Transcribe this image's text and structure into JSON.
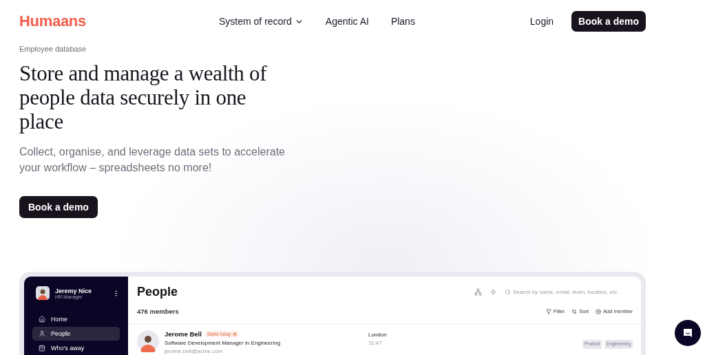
{
  "brand": "Humaans",
  "nav": [
    {
      "label": "System of record",
      "kind": "menu"
    },
    {
      "label": "Agentic AI",
      "kind": "link"
    },
    {
      "label": "Plans",
      "kind": "link"
    }
  ],
  "login": "Login",
  "header_cta": "Book a demo",
  "hero": {
    "eyebrow": "Employee database",
    "title": "Store and manage a wealth of people data securely in one place",
    "subtitle": "Collect, organise, and leverage data sets to accelerate your workflow – spreadsheets no more!",
    "cta": "Book a demo"
  },
  "app": {
    "user": {
      "name": "Jeremy Nice",
      "role": "HR Manager"
    },
    "sidebar": [
      {
        "label": "Home",
        "selected": false
      },
      {
        "label": "People",
        "selected": true
      },
      {
        "label": "Who's away",
        "selected": false
      }
    ],
    "title": "People",
    "count": "476 members",
    "search": {
      "placeholder": "Search by name, email, team, location, etc."
    },
    "actions": [
      "Filter",
      "Sort",
      "Add member"
    ],
    "rows": [
      {
        "name": "Jerome Bell",
        "badge": "Starts today",
        "title": "Software Development Manager in Engineering",
        "email": "jerome.bell@acme.com",
        "location": "London",
        "time": "11:47",
        "tags": [
          "Product",
          "Engineering"
        ]
      }
    ]
  }
}
